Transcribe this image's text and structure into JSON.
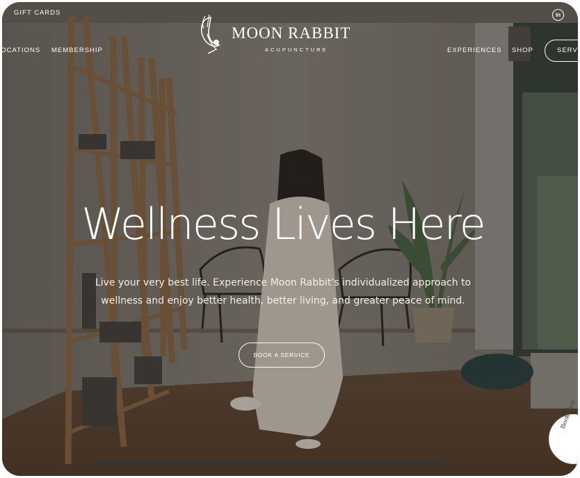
{
  "nav": {
    "gift_cards": "GIFT CARDS",
    "locations": "LOCATIONS",
    "membership": "MEMBERSHIP",
    "experiences": "EXPERIENCES",
    "shop": "SHOP",
    "services": "SERVICES"
  },
  "logo": {
    "name": "MOON RABBIT",
    "subtitle": "ACUPUNCTURE"
  },
  "social": {
    "linkedin_glyph": "in",
    "icon": "linkedin-icon"
  },
  "hero": {
    "headline": "Wellness Lives Here",
    "subtext": "Live your very best life. Experience Moon Rabbit's individualized approach to wellness and enjoy better health, better living, and greater peace of mind.",
    "cta": "BOOK A SERVICE"
  },
  "badge": {
    "text": "Book Now"
  },
  "colors": {
    "overlay": "#3a332d",
    "text": "#ffffff"
  }
}
